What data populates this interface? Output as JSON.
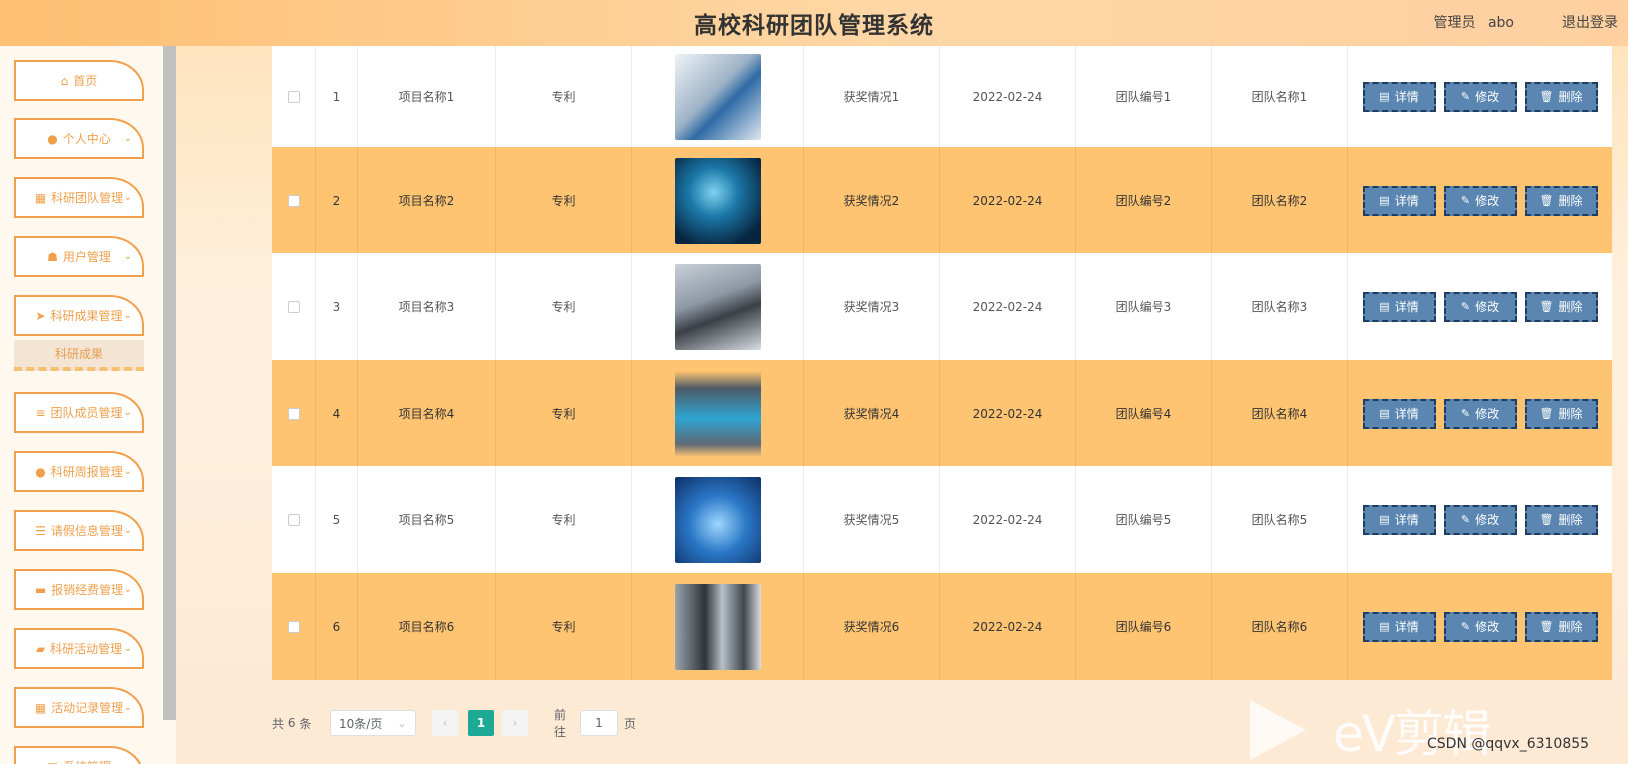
{
  "header": {
    "title": "高校科研团队管理系统",
    "role": "管理员",
    "username": "abo",
    "logout": "退出登录"
  },
  "sidebar": {
    "items": [
      {
        "label": "首页",
        "icon": "home-icon",
        "glyph": "⌂",
        "arrow": false
      },
      {
        "label": "个人中心",
        "icon": "user-icon",
        "glyph": "●",
        "arrow": true
      },
      {
        "label": "科研团队管理",
        "icon": "grid-icon",
        "glyph": "▦",
        "arrow": true
      },
      {
        "label": "用户管理",
        "icon": "user-icon",
        "glyph": "☗",
        "arrow": true
      },
      {
        "label": "科研成果管理",
        "icon": "send-icon",
        "glyph": "➤",
        "arrow": true
      },
      {
        "label": "团队成员管理",
        "icon": "list-icon",
        "glyph": "≡",
        "arrow": true
      },
      {
        "label": "科研周报管理",
        "icon": "user-icon",
        "glyph": "●",
        "arrow": true
      },
      {
        "label": "请假信息管理",
        "icon": "sliders-icon",
        "glyph": "☰",
        "arrow": true
      },
      {
        "label": "报销经费管理",
        "icon": "ticket-icon",
        "glyph": "▬",
        "arrow": true
      },
      {
        "label": "科研活动管理",
        "icon": "chat-icon",
        "glyph": "▰",
        "arrow": true
      },
      {
        "label": "活动记录管理",
        "icon": "grid-icon",
        "glyph": "▦",
        "arrow": true
      },
      {
        "label": "系统管理",
        "icon": "grid-icon",
        "glyph": "▦",
        "arrow": true
      }
    ],
    "active_submenu": "科研成果"
  },
  "table": {
    "rows": [
      {
        "index": "1",
        "name": "项目名称1",
        "type": "专利",
        "award": "获奖情况1",
        "date": "2022-02-24",
        "team_no": "团队编号1",
        "team_name": "团队名称1"
      },
      {
        "index": "2",
        "name": "项目名称2",
        "type": "专利",
        "award": "获奖情况2",
        "date": "2022-02-24",
        "team_no": "团队编号2",
        "team_name": "团队名称2"
      },
      {
        "index": "3",
        "name": "项目名称3",
        "type": "专利",
        "award": "获奖情况3",
        "date": "2022-02-24",
        "team_no": "团队编号3",
        "team_name": "团队名称3"
      },
      {
        "index": "4",
        "name": "项目名称4",
        "type": "专利",
        "award": "获奖情况4",
        "date": "2022-02-24",
        "team_no": "团队编号4",
        "team_name": "团队名称4"
      },
      {
        "index": "5",
        "name": "项目名称5",
        "type": "专利",
        "award": "获奖情况5",
        "date": "2022-02-24",
        "team_no": "团队编号5",
        "team_name": "团队名称5"
      },
      {
        "index": "6",
        "name": "项目名称6",
        "type": "专利",
        "award": "获奖情况6",
        "date": "2022-02-24",
        "team_no": "团队编号6",
        "team_name": "团队名称6"
      }
    ],
    "actions": {
      "detail": "详情",
      "edit": "修改",
      "delete": "删除"
    },
    "action_color": "#5a86b1",
    "alt_row_color": "#ffc471"
  },
  "pagination": {
    "total_prefix": "共",
    "total": "6",
    "total_suffix": "条",
    "page_size": "10条/页",
    "current_page": "1",
    "goto_prefix": "前往",
    "goto_value": "1",
    "goto_suffix": "页"
  },
  "watermark": {
    "text": "eV剪辑",
    "csdn": "CSDN @qqvx_6310855"
  }
}
